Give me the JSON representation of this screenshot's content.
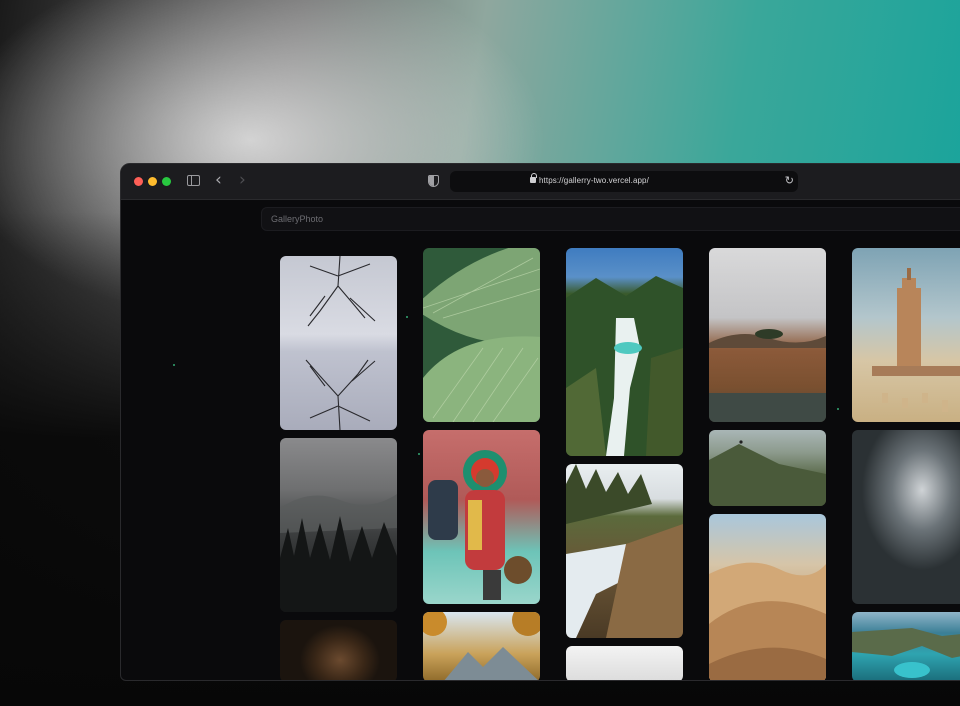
{
  "browser": {
    "url": "https://gallerry-two.vercel.app/",
    "icons": {
      "sidebar": "sidebar-toggle-icon",
      "back": "chevron-left-icon",
      "forward": "chevron-right-icon",
      "shield": "shield-icon",
      "lock": "lock-icon",
      "reload": "reload-icon"
    },
    "glyphs": {
      "back": "‹",
      "forward": "›",
      "reload": "↻"
    }
  },
  "app": {
    "title": "GalleryPhoto"
  },
  "gallery": {
    "photos": [
      {
        "subject": "bare branches reflected in fog"
      },
      {
        "subject": "foggy pine forest"
      },
      {
        "subject": "face with golden lights"
      },
      {
        "subject": "green leaf close-up"
      },
      {
        "subject": "person in colorful costume"
      },
      {
        "subject": "autumn leaves over mountains"
      },
      {
        "subject": "turquoise waterfall in canyon"
      },
      {
        "subject": "rocky river waterfall"
      },
      {
        "subject": "white misty sky"
      },
      {
        "subject": "misty lake with trees"
      },
      {
        "subject": "hill ridge with person"
      },
      {
        "subject": "sand dunes"
      },
      {
        "subject": "Koutoubia minaret tower"
      },
      {
        "subject": "sparkling ocean water"
      },
      {
        "subject": "turquoise cove cliffs"
      }
    ]
  },
  "colors": {
    "bg_teal": "#0fa39c",
    "window_bg": "#0a0a0c",
    "titlebar": "#1c1c1f",
    "close": "#fe5f57",
    "minimize": "#febc2e",
    "maximize": "#28c840"
  }
}
